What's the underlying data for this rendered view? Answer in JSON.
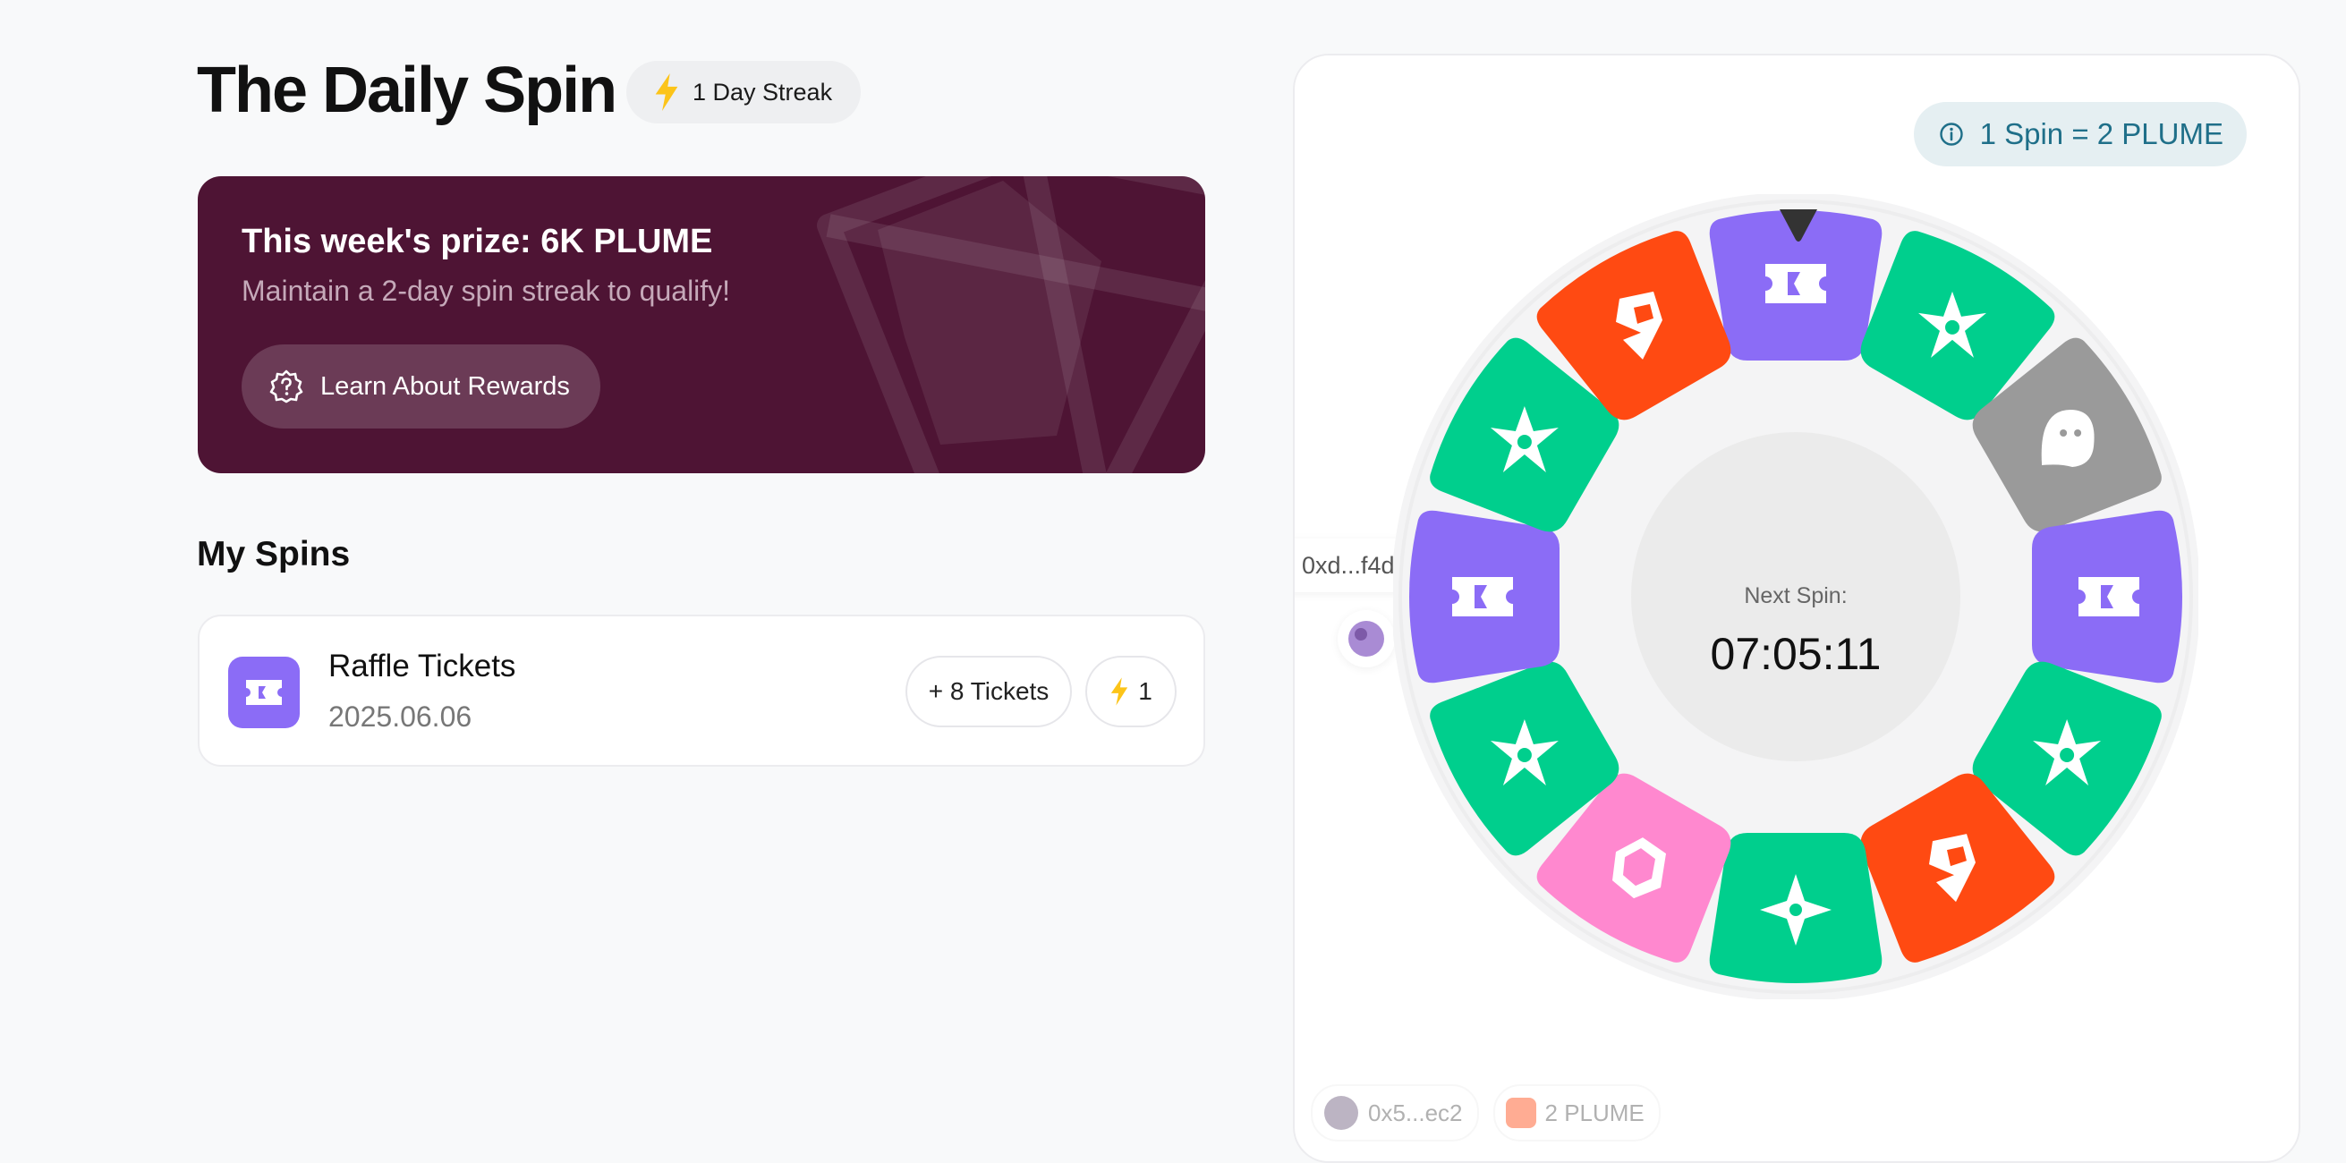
{
  "header": {
    "title": "The Daily Spin",
    "streak_label": "1 Day Streak",
    "streak_icon": "lightning-icon"
  },
  "prize_card": {
    "title": "This week's prize: 6K PLUME",
    "subtitle": "Maintain a 2-day spin streak to qualify!",
    "button_label": "Learn About Rewards",
    "background": "#4e1434"
  },
  "my_spins": {
    "section_title": "My Spins",
    "items": [
      {
        "name": "Raffle Tickets",
        "date": "2025.06.06",
        "reward": "+ 8 Tickets",
        "streak_count": "1",
        "icon": "ticket-icon"
      }
    ]
  },
  "wheel": {
    "rate_label": "1 Spin = 2 PLUME",
    "next_spin_label": "Next Spin:",
    "countdown": "07:05:11",
    "segments": [
      {
        "icon": "ticket-icon",
        "color": "#8b6cf6"
      },
      {
        "icon": "shuriken-icon",
        "color": "#00cf8d"
      },
      {
        "icon": "ghost-icon",
        "color": "#9a9a9a"
      },
      {
        "icon": "ticket-icon",
        "color": "#8b6cf6"
      },
      {
        "icon": "shuriken-icon",
        "color": "#00cf8d"
      },
      {
        "icon": "plume-logo-icon",
        "color": "#ff4a12"
      },
      {
        "icon": "star-icon",
        "color": "#00cf8d"
      },
      {
        "icon": "cube-icon",
        "color": "#ff88cf"
      },
      {
        "icon": "shuriken-icon",
        "color": "#00cf8d"
      },
      {
        "icon": "ticket-icon",
        "color": "#8b6cf6"
      },
      {
        "icon": "shuriken-icon",
        "color": "#00cf8d"
      },
      {
        "icon": "plume-logo-icon",
        "color": "#ff4a12"
      }
    ]
  },
  "activity": {
    "user_label": "0xd...f4d",
    "feed": [
      {
        "user": "0x5...ec2",
        "reward": "2 PLUME"
      }
    ]
  }
}
